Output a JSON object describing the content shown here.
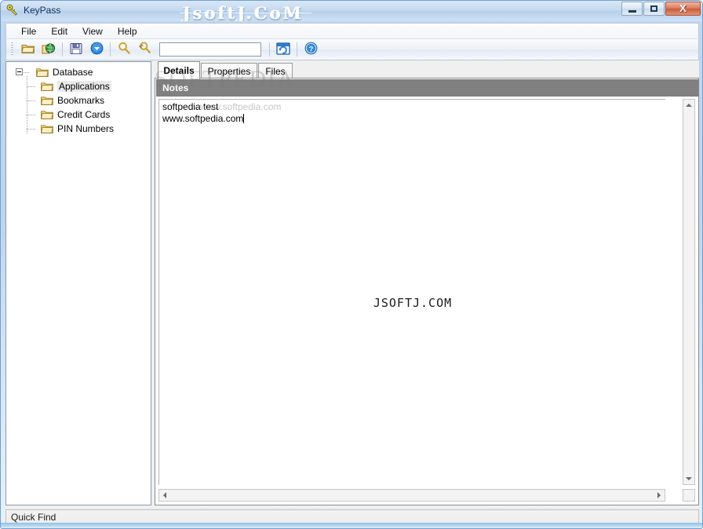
{
  "window": {
    "title": "KeyPass",
    "app_icon": "key-icon",
    "watermark_title": "JsoftJ.CoM",
    "controls": {
      "minimize": "minimize-button",
      "maximize": "maximize-button",
      "close_glyph": "X"
    }
  },
  "menubar": {
    "items": [
      {
        "label": "File"
      },
      {
        "label": "Edit"
      },
      {
        "label": "View"
      },
      {
        "label": "Help"
      }
    ]
  },
  "toolbar": {
    "buttons": [
      {
        "name": "open-folder-icon",
        "title": "Open"
      },
      {
        "name": "open-web-icon",
        "title": "Open from web"
      },
      {
        "name": "save-icon",
        "title": "Save"
      },
      {
        "name": "sync-icon",
        "title": "Synchronize"
      },
      {
        "name": "find-icon",
        "title": "Find"
      },
      {
        "name": "find-next-icon",
        "title": "Find next"
      },
      {
        "name": "window-refresh-icon",
        "title": "Refresh"
      },
      {
        "name": "help-icon",
        "title": "Help"
      }
    ],
    "search": {
      "value": "",
      "placeholder": ""
    }
  },
  "tree": {
    "root": {
      "label": "Database",
      "expanded": true
    },
    "children": [
      {
        "label": "Applications",
        "selected": true
      },
      {
        "label": "Bookmarks",
        "selected": false
      },
      {
        "label": "Credit Cards",
        "selected": false
      },
      {
        "label": "PIN Numbers",
        "selected": false
      }
    ]
  },
  "details": {
    "tabs": [
      {
        "label": "Details",
        "active": true
      },
      {
        "label": "Properties",
        "active": false
      },
      {
        "label": "Files",
        "active": false
      }
    ],
    "notes": {
      "header": "Notes",
      "lines": [
        "softpedia test",
        "www.softpedia.com"
      ]
    },
    "center_watermark": "JSOFTJ.COM"
  },
  "overlay_watermark": {
    "big": "SOFTPEDIA",
    "small": "www.softpedia.com"
  },
  "statusbar": {
    "text": "Quick Find"
  },
  "colors": {
    "titlebar_blue": "#c4d9f0",
    "close_red": "#c85c3c",
    "notes_header_gray": "#808080",
    "folder_yellow": "#ecc94b",
    "accent_blue": "#1e6fc4"
  }
}
